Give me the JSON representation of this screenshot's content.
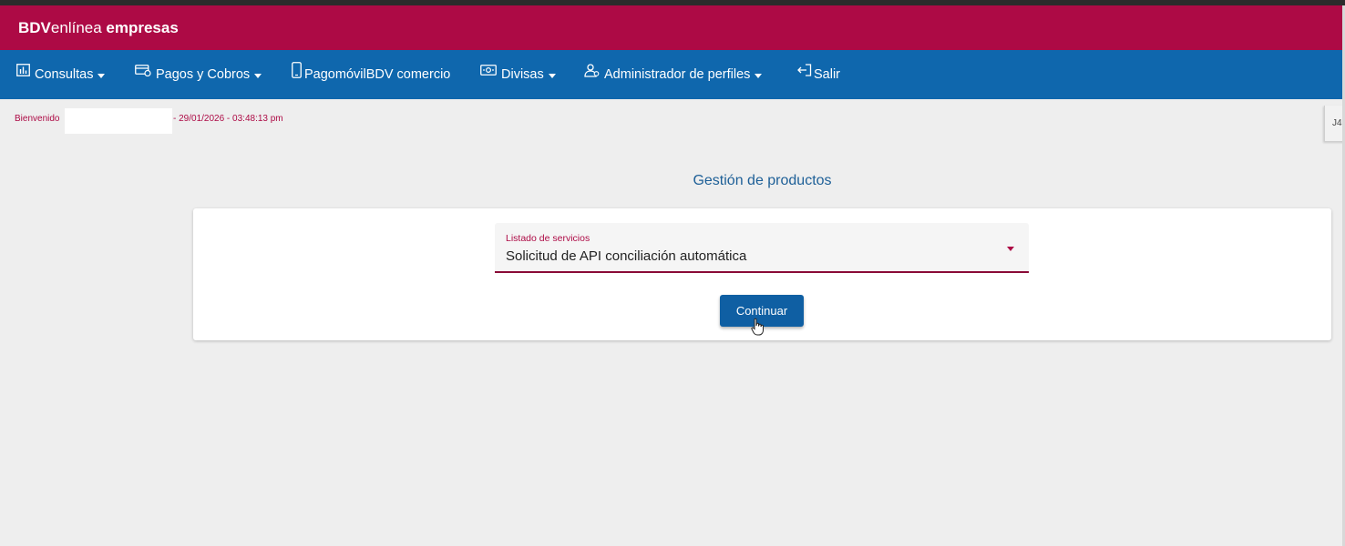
{
  "brand": {
    "part1": "BDV",
    "part2": "enlínea",
    "part3": " empresas"
  },
  "colors": {
    "brand_bar": "#ad0a45",
    "nav_bar": "#0f67ad",
    "accent_text": "#ad0a45",
    "button": "#0f5fa3",
    "title": "#1d5f97"
  },
  "nav": {
    "items": [
      {
        "label": "Consultas",
        "icon": "chart-icon",
        "has_dropdown": true
      },
      {
        "label": "Pagos y Cobros",
        "icon": "payment-card-icon",
        "has_dropdown": true
      },
      {
        "label": "PagomóvilBDV comercio",
        "icon": "mobile-phone-icon",
        "has_dropdown": false
      },
      {
        "label": "Divisas",
        "icon": "banknote-icon",
        "has_dropdown": true
      },
      {
        "label": "Administrador de perfiles",
        "icon": "users-icon",
        "has_dropdown": true
      },
      {
        "label": "Salir",
        "icon": "logout-icon",
        "has_dropdown": false
      }
    ]
  },
  "welcome": {
    "label": "Bienvenido",
    "datetime": "- 29/01/2026 - 03:48:13 pm"
  },
  "edge_tab": {
    "text": "J4"
  },
  "main": {
    "title": "Gestión de productos",
    "select": {
      "label": "Listado de servicios",
      "value": "Solicitud de API conciliación automática"
    },
    "continue_label": "Continuar"
  }
}
